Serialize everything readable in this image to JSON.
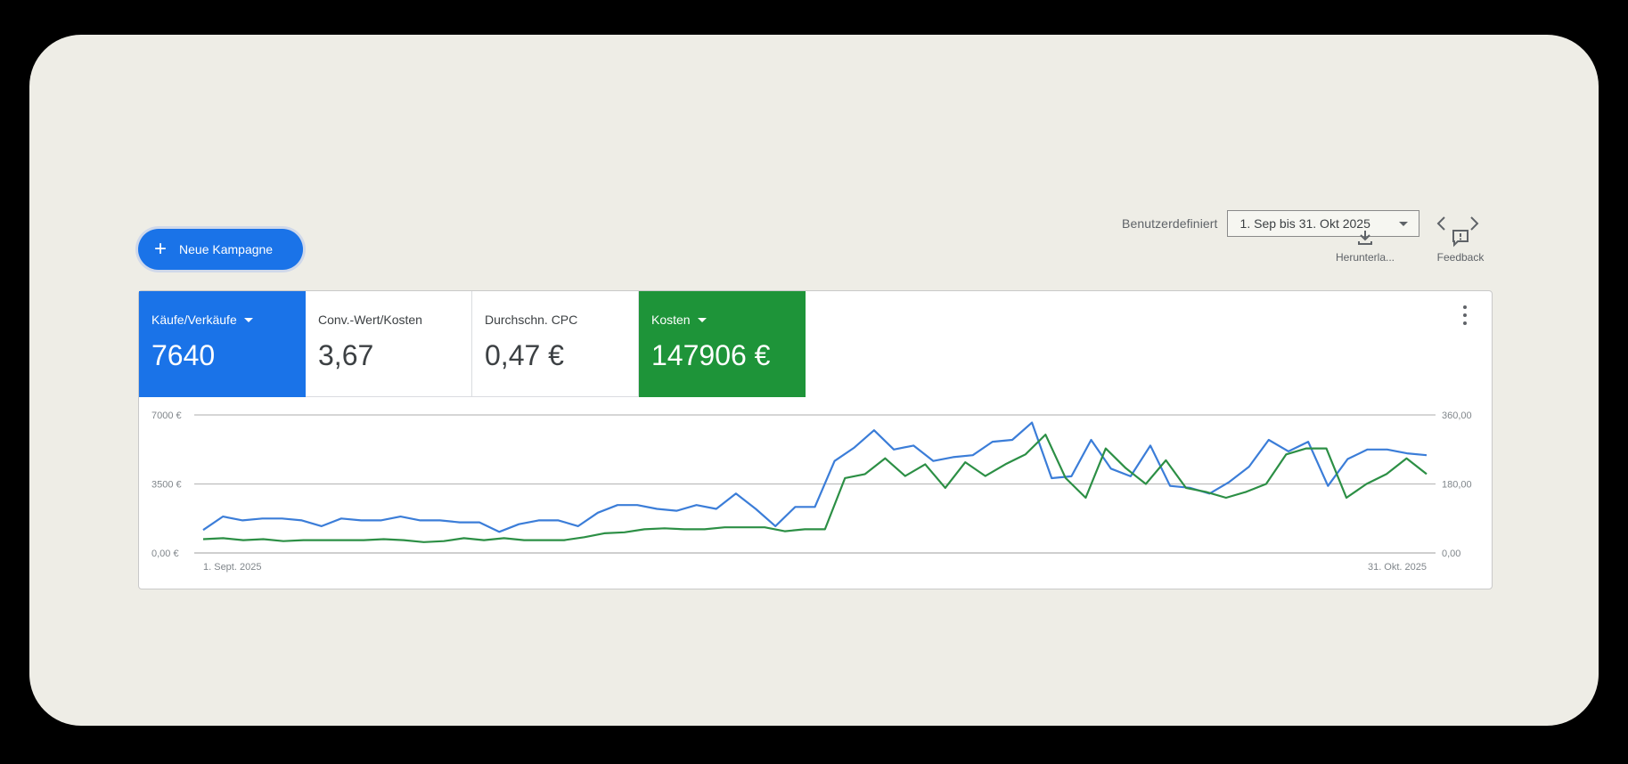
{
  "toolbar": {
    "range_label": "Benutzerdefiniert",
    "range_value": "1. Sep bis 31. Okt 2025",
    "download_label": "Herunterla...",
    "feedback_label": "Feedback"
  },
  "actions": {
    "new_campaign_label": "Neue Kampagne"
  },
  "kpis": [
    {
      "label": "Käufe/Verkäufe",
      "value": "7640",
      "color": "#1a73e8",
      "has_dropdown": true
    },
    {
      "label": "Conv.-Wert/Kosten",
      "value": "3,67"
    },
    {
      "label": "Durchschn. CPC",
      "value": "0,47 €"
    },
    {
      "label": "Kosten",
      "value": "147906 €",
      "color": "#1e9439",
      "has_dropdown": true
    }
  ],
  "chart_data": {
    "type": "line",
    "x_start_label": "1. Sept. 2025",
    "x_end_label": "31. Okt. 2025",
    "left_axis": {
      "ticks": [
        "0,00 €",
        "3500 €",
        "7000 €"
      ],
      "ylim": [
        0,
        7000
      ]
    },
    "right_axis": {
      "ticks": [
        "0,00",
        "180,00",
        "360,00"
      ],
      "ylim": [
        0,
        360
      ]
    },
    "grid": true,
    "series": [
      {
        "axis": "right",
        "color": "#3b7dd8",
        "values": [
          60,
          95,
          85,
          90,
          90,
          85,
          70,
          90,
          85,
          85,
          95,
          85,
          85,
          80,
          80,
          55,
          75,
          85,
          85,
          70,
          105,
          125,
          125,
          115,
          110,
          125,
          115,
          155,
          115,
          70,
          120,
          120,
          240,
          275,
          320,
          270,
          280,
          240,
          250,
          255,
          290,
          295,
          340,
          195,
          200,
          295,
          220,
          200,
          280,
          175,
          170,
          155,
          185,
          225,
          295,
          265,
          290,
          175,
          245,
          270,
          270,
          260,
          255
        ]
      },
      {
        "axis": "left",
        "color": "#2c8f45",
        "values": [
          700,
          750,
          650,
          700,
          600,
          650,
          650,
          650,
          650,
          700,
          650,
          550,
          600,
          750,
          650,
          750,
          650,
          650,
          650,
          800,
          1000,
          1050,
          1200,
          1250,
          1200,
          1200,
          1300,
          1300,
          1300,
          1100,
          1200,
          1200,
          3800,
          4000,
          4800,
          3900,
          4500,
          3300,
          4600,
          3900,
          4500,
          5000,
          6000,
          3800,
          2800,
          5300,
          4300,
          3500,
          4700,
          3300,
          3100,
          2800,
          3100,
          3500,
          5000,
          5300,
          5300,
          2800,
          3500,
          4000,
          4800,
          4000
        ]
      }
    ]
  }
}
